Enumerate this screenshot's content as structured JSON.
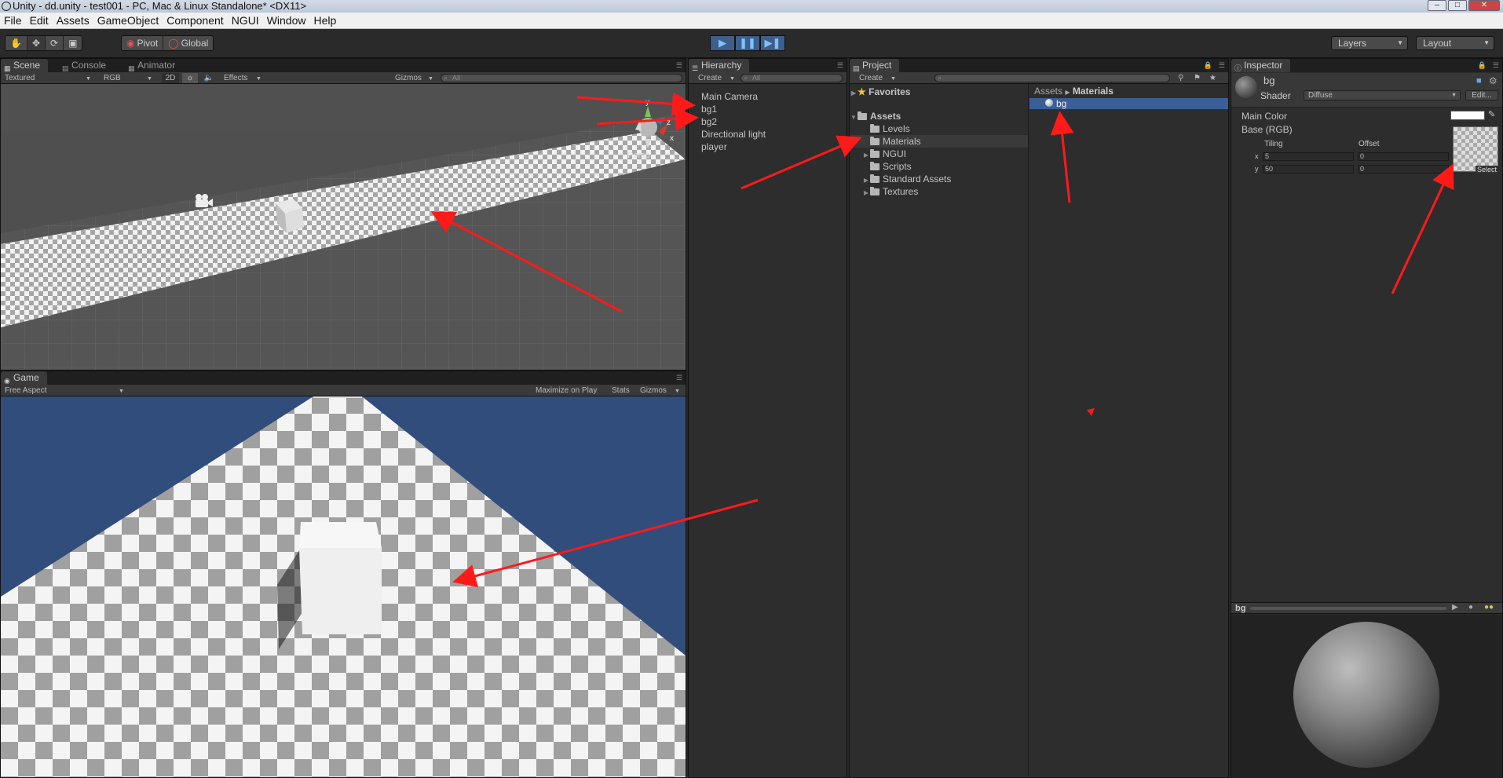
{
  "window": {
    "title": "Unity - dd.unity - test001 - PC, Mac & Linux Standalone* <DX11>"
  },
  "menu": [
    "File",
    "Edit",
    "Assets",
    "GameObject",
    "Component",
    "NGUI",
    "Window",
    "Help"
  ],
  "toolbar": {
    "pivot_label": "Pivot",
    "global_label": "Global",
    "layers_label": "Layers",
    "layout_label": "Layout"
  },
  "scene": {
    "tabs": [
      "Scene",
      "Console",
      "Animator"
    ],
    "shading": "Textured",
    "render_mode": "RGB",
    "mode_2d": "2D",
    "effects": "Effects",
    "gizmos": "Gizmos",
    "search_placeholder": "All",
    "persp_label": "Persp",
    "axis_y": "y",
    "axis_z": "z",
    "axis_x": "x"
  },
  "game": {
    "tab": "Game",
    "aspect": "Free Aspect",
    "maximize": "Maximize on Play",
    "stats": "Stats",
    "gizmos": "Gizmos",
    "sky_color": "#314d7c"
  },
  "hierarchy": {
    "tab": "Hierarchy",
    "create": "Create",
    "search_placeholder": "All",
    "items": [
      "Main Camera",
      "bg1",
      "bg2",
      "Directional light",
      "player"
    ]
  },
  "project": {
    "tab": "Project",
    "create": "Create",
    "favorites": "Favorites",
    "assets": "Assets",
    "folders": [
      "Levels",
      "Materials",
      "NGUI",
      "Scripts",
      "Standard Assets",
      "Textures"
    ],
    "breadcrumb_root": "Assets",
    "breadcrumb_leaf": "Materials",
    "files": [
      "bg"
    ]
  },
  "inspector": {
    "tab": "Inspector",
    "object_name": "bg",
    "shader_label": "Shader",
    "shader_value": "Diffuse",
    "edit_button": "Edit...",
    "main_color": "Main Color",
    "base_rgb": "Base (RGB)",
    "tiling": "Tiling",
    "offset": "Offset",
    "x_label": "x",
    "y_label": "y",
    "tiling_x": "5",
    "tiling_y": "50",
    "offset_x": "0",
    "offset_y": "0",
    "select_label": "Select",
    "preview_name": "bg"
  },
  "colors": {
    "annotation_arrow": "#ff1a1a",
    "selection": "#3a5f96",
    "play_accent": "#3d5f8a"
  }
}
